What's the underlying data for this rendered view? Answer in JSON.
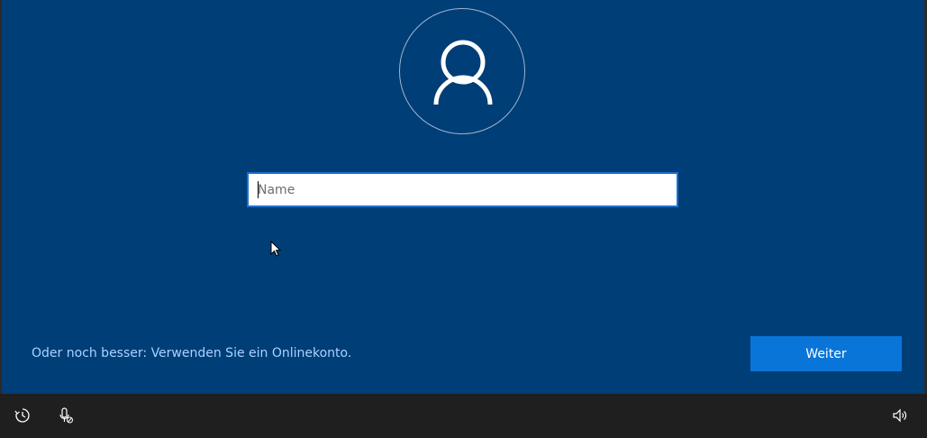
{
  "main": {
    "avatar_icon": "user-icon",
    "name_input": {
      "value": "",
      "placeholder": "Name"
    },
    "online_account_link": "Oder noch besser: Verwenden Sie ein Onlinekonto.",
    "next_button": "Weiter"
  },
  "taskbar": {
    "left_icons": [
      "ease-of-access-icon",
      "microphone-icon"
    ],
    "right_icons": [
      "volume-icon"
    ]
  },
  "colors": {
    "background": "#003e77",
    "accent": "#0a75d8",
    "link": "#a8d3ff",
    "taskbar": "#1f1f1f"
  }
}
